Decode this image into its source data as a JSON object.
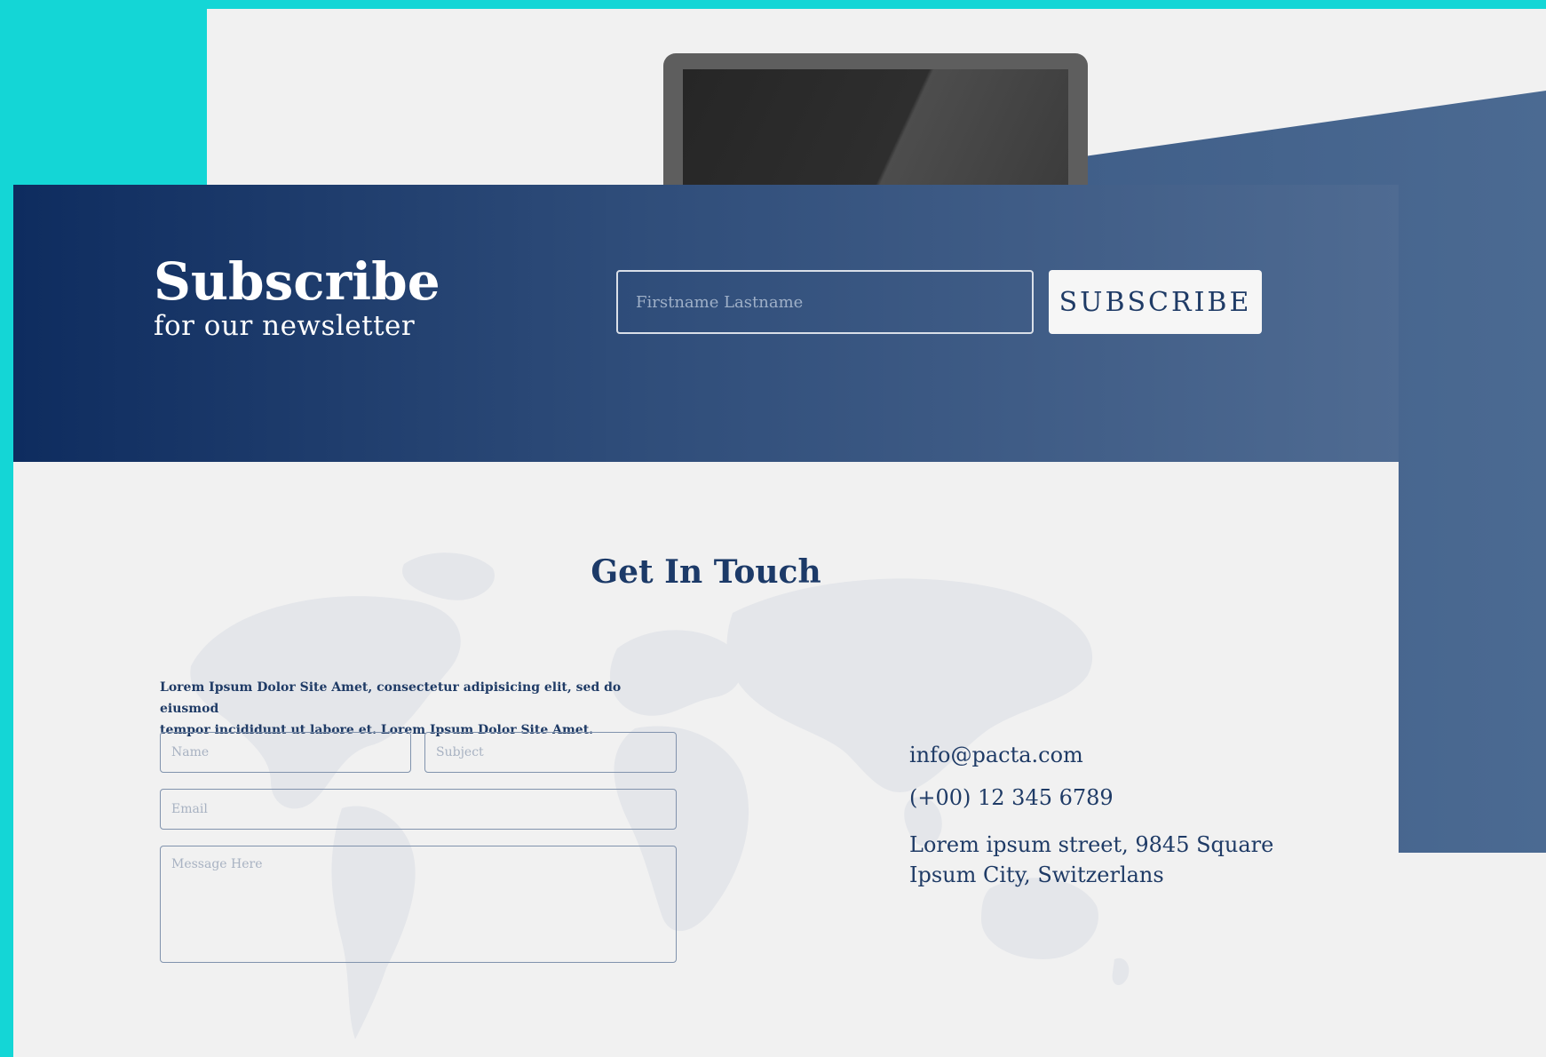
{
  "subscribe": {
    "title": "Subscribe",
    "subtitle": "for our newsletter",
    "input_placeholder": "Firstname Lastname",
    "button_label": "SUBSCRIBE"
  },
  "contact": {
    "title": "Get In Touch",
    "description_line1": "Lorem Ipsum Dolor Site Amet, consectetur adipisicing elit, sed do eiusmod",
    "description_line2": "tempor incididunt ut labore et. Lorem Ipsum Dolor Site Amet.",
    "name_placeholder": "Name",
    "subject_placeholder": "Subject",
    "email_placeholder": "Email",
    "message_placeholder": "Message Here",
    "email": "info@pacta.com",
    "phone": "(+00) 12 345 6789",
    "address_line1": "Lorem ipsum street, 9845 Square",
    "address_line2": "Ipsum City, Switzerlans"
  },
  "colors": {
    "background": "#14d6d6",
    "banner_dark": "#0e2c5f",
    "banner_light": "#4f6b92",
    "text_navy": "#1f3b66",
    "page": "#f1f1f1"
  }
}
